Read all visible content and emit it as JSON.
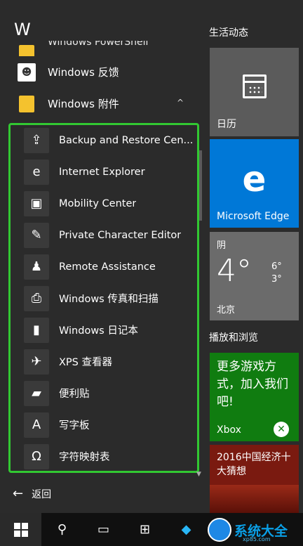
{
  "left": {
    "letter": "W",
    "top_items": [
      {
        "label": "Windows PowerShell",
        "icon": "folder-icon"
      },
      {
        "label": "Windows 反馈",
        "icon": "feedback-icon"
      },
      {
        "label": "Windows 附件",
        "icon": "folder-icon",
        "chevron": "^"
      }
    ],
    "sub_items": [
      {
        "label": "Backup and Restore Cen...",
        "icon": "backup-icon",
        "glyph": "⇪"
      },
      {
        "label": "Internet Explorer",
        "icon": "internet-explorer-icon",
        "glyph": "e"
      },
      {
        "label": "Mobility Center",
        "icon": "mobility-center-icon",
        "glyph": "▣"
      },
      {
        "label": "Private Character Editor",
        "icon": "character-editor-icon",
        "glyph": "✎"
      },
      {
        "label": "Remote Assistance",
        "icon": "remote-assistance-icon",
        "glyph": "♟"
      },
      {
        "label": "Windows 传真和扫描",
        "icon": "fax-scan-icon",
        "glyph": "⎙"
      },
      {
        "label": "Windows 日记本",
        "icon": "journal-icon",
        "glyph": "▮"
      },
      {
        "label": "XPS 查看器",
        "icon": "xps-viewer-icon",
        "glyph": "✈"
      },
      {
        "label": "便利贴",
        "icon": "sticky-notes-icon",
        "glyph": "▰"
      },
      {
        "label": "写字板",
        "icon": "wordpad-icon",
        "glyph": "A"
      },
      {
        "label": "字符映射表",
        "icon": "character-map-icon",
        "glyph": "Ω"
      }
    ],
    "back_label": "返回"
  },
  "right": {
    "group1_title": "生活动态",
    "calendar_label": "日历",
    "edge_label": "Microsoft Edge",
    "weather": {
      "condition": "阴",
      "temp": "4°",
      "high": "6°",
      "low": "3°",
      "city": "北京"
    },
    "group2_title": "播放和浏览",
    "xbox_promo": "更多游戏方式，加入我们吧!",
    "xbox_label": "Xbox",
    "news_text": "2016中国经济十大猜想"
  },
  "taskbar": {
    "watermark_text": "系统大全",
    "watermark_url": "xp85.com"
  },
  "colors": {
    "highlight": "#32c832",
    "edge_tile": "#0078d7",
    "xbox_tile": "#107c10"
  }
}
